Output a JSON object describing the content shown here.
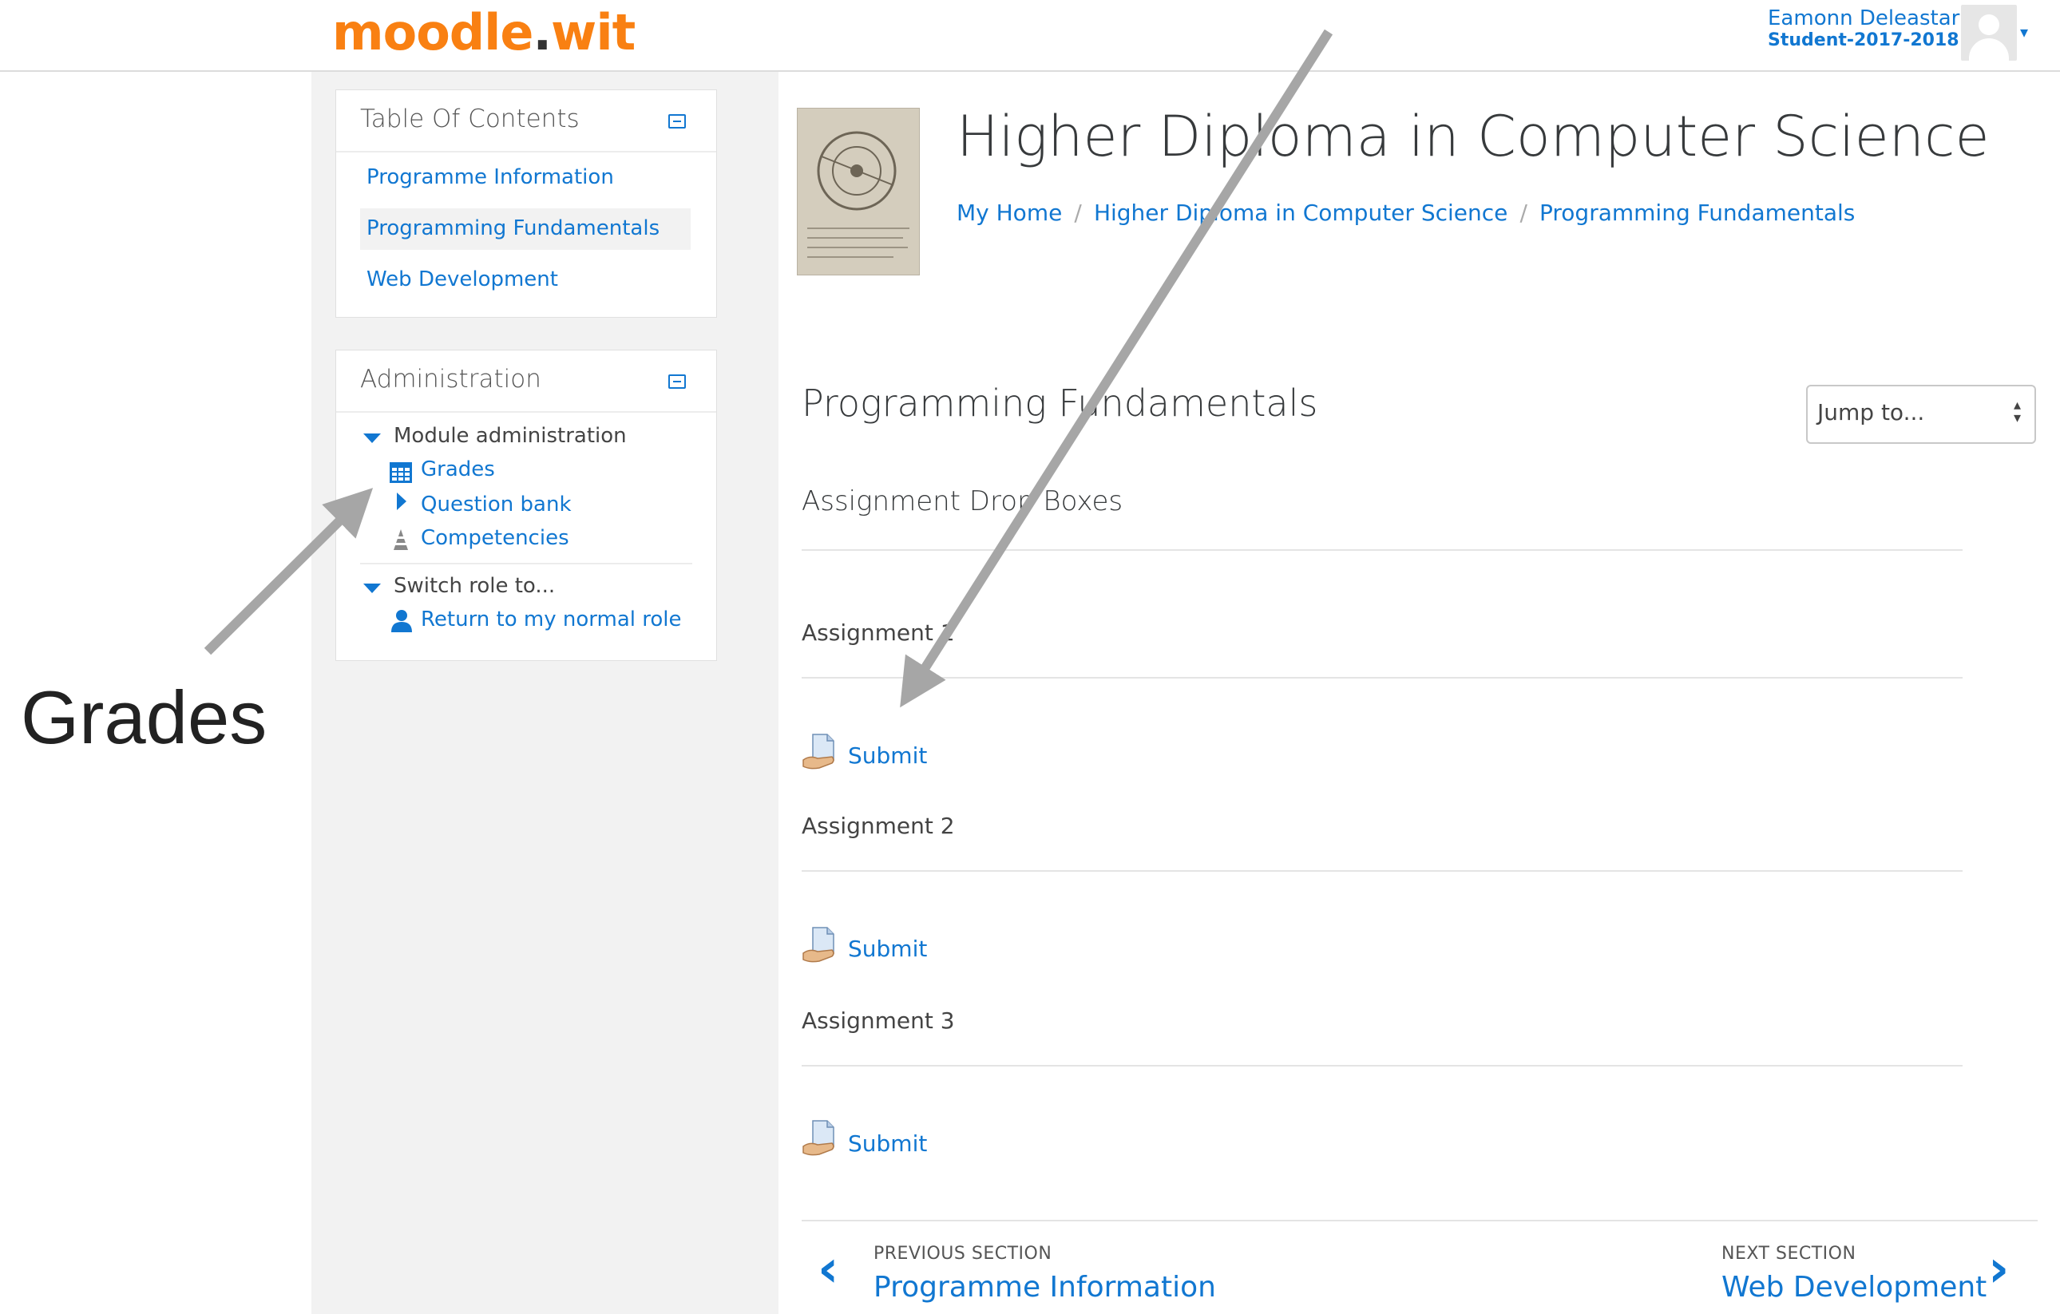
{
  "header": {
    "logo_main": "moodle",
    "logo_dot": ".",
    "logo_suffix": "wit",
    "user_name": "Eamonn Deleastar",
    "user_role": "Student-2017-2018"
  },
  "toc": {
    "title": "Table Of Contents",
    "items": [
      {
        "label": "Programme Information"
      },
      {
        "label": "Programming Fundamentals"
      },
      {
        "label": "Web Development"
      }
    ]
  },
  "admin": {
    "title": "Administration",
    "module_admin": "Module administration",
    "grades": "Grades",
    "question_bank": "Question bank",
    "competencies": "Competencies",
    "switch_role": "Switch role to...",
    "return_role": "Return to my normal role"
  },
  "course": {
    "title": "Higher Diploma in Computer Science",
    "breadcrumb": [
      "My Home",
      "Higher Diploma in Computer Science",
      "Programming Fundamentals"
    ],
    "breadcrumb_sep": "/"
  },
  "section": {
    "title": "Programming Fundamentals",
    "jump_to": "Jump to...",
    "subheading": "Assignment Drop Boxes",
    "assignments": [
      {
        "label": "Assignment 1",
        "submit": "Submit"
      },
      {
        "label": "Assignment 2",
        "submit": "Submit"
      },
      {
        "label": "Assignment 3",
        "submit": "Submit"
      }
    ],
    "prev_label": "PREVIOUS SECTION",
    "prev_link": "Programme Information",
    "next_label": "NEXT SECTION",
    "next_link": "Web Development"
  },
  "annotation": {
    "label": "Grades",
    "arrow_color": "#a6a6a6"
  },
  "colors": {
    "link": "#1177d1",
    "logo_orange": "#f98012",
    "sidebar_bg": "#f2f2f2"
  }
}
